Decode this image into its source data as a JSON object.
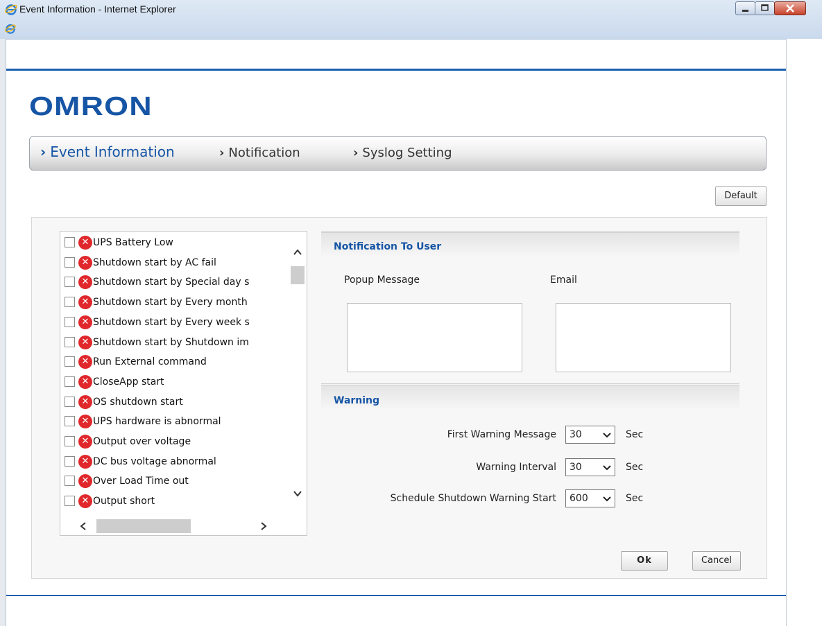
{
  "window": {
    "title": "Event Information - Internet Explorer"
  },
  "brand": {
    "logo_text": "OMRON",
    "color": "#1655a5"
  },
  "tabs": [
    {
      "label": "Event Information",
      "active": true
    },
    {
      "label": "Notification",
      "active": false
    },
    {
      "label": "Syslog Setting",
      "active": false
    }
  ],
  "buttons": {
    "default_label": "Default",
    "ok_label": "Ok",
    "cancel_label": "Cancel"
  },
  "event_list": {
    "items": [
      {
        "label": "UPS Battery Low",
        "checked": false,
        "status_icon": "x-circle-icon"
      },
      {
        "label": "Shutdown start by AC fail",
        "checked": false,
        "status_icon": "x-circle-icon"
      },
      {
        "label": "Shutdown start by Special day s",
        "checked": false,
        "status_icon": "x-circle-icon"
      },
      {
        "label": "Shutdown start by Every month",
        "checked": false,
        "status_icon": "x-circle-icon"
      },
      {
        "label": "Shutdown start by Every week s",
        "checked": false,
        "status_icon": "x-circle-icon"
      },
      {
        "label": "Shutdown start by Shutdown im",
        "checked": false,
        "status_icon": "x-circle-icon"
      },
      {
        "label": "Run External command",
        "checked": false,
        "status_icon": "x-circle-icon"
      },
      {
        "label": "CloseApp start",
        "checked": false,
        "status_icon": "x-circle-icon"
      },
      {
        "label": "OS shutdown start",
        "checked": false,
        "status_icon": "x-circle-icon"
      },
      {
        "label": "UPS hardware is abnormal",
        "checked": false,
        "status_icon": "x-circle-icon"
      },
      {
        "label": "Output over voltage",
        "checked": false,
        "status_icon": "x-circle-icon"
      },
      {
        "label": "DC bus voltage abnormal",
        "checked": false,
        "status_icon": "x-circle-icon"
      },
      {
        "label": "Over Load Time out",
        "checked": false,
        "status_icon": "x-circle-icon"
      },
      {
        "label": "Output short",
        "checked": false,
        "status_icon": "x-circle-icon"
      }
    ]
  },
  "notification": {
    "section_title": "Notification To User",
    "popup_label": "Popup Message",
    "email_label": "Email"
  },
  "warning": {
    "section_title": "Warning",
    "unit": "Sec",
    "rows": [
      {
        "label": "First Warning Message",
        "value": "30"
      },
      {
        "label": "Warning Interval",
        "value": "30"
      },
      {
        "label": "Schedule Shutdown Warning Start",
        "value": "600"
      }
    ]
  }
}
